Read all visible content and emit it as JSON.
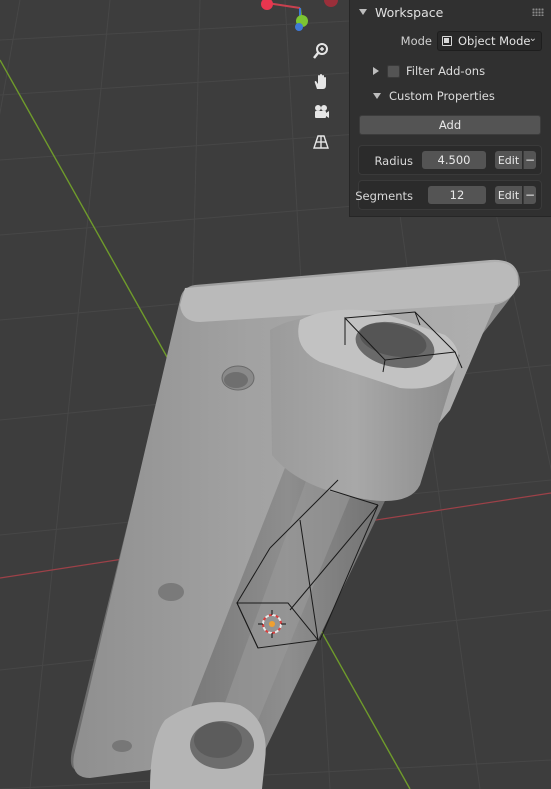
{
  "panel": {
    "title": "Workspace",
    "mode_label": "Mode",
    "mode_value": "Object Mode",
    "filter_addons_label": "Filter Add-ons",
    "filter_addons_checked": false,
    "custom_properties_label": "Custom Properties",
    "add_button_label": "Add",
    "properties": [
      {
        "name": "Radius",
        "value": "4.500",
        "edit_label": "Edit",
        "remove_label": "−"
      },
      {
        "name": "Segments",
        "value": "12",
        "edit_label": "Edit",
        "remove_label": "−"
      }
    ]
  },
  "gizmo": {
    "axis_colors": {
      "x": "#e8364f",
      "y": "#7cc532",
      "z": "#3f79d6"
    },
    "tools": [
      "zoom-icon",
      "hand-pan-icon",
      "camera-icon",
      "grid-perspective-icon"
    ]
  },
  "viewport": {
    "background": "#3d3d3d",
    "grid_line_color": "#4a4a4a",
    "x_axis_color": "#a3454c",
    "y_axis_color": "#6e9a2a"
  }
}
